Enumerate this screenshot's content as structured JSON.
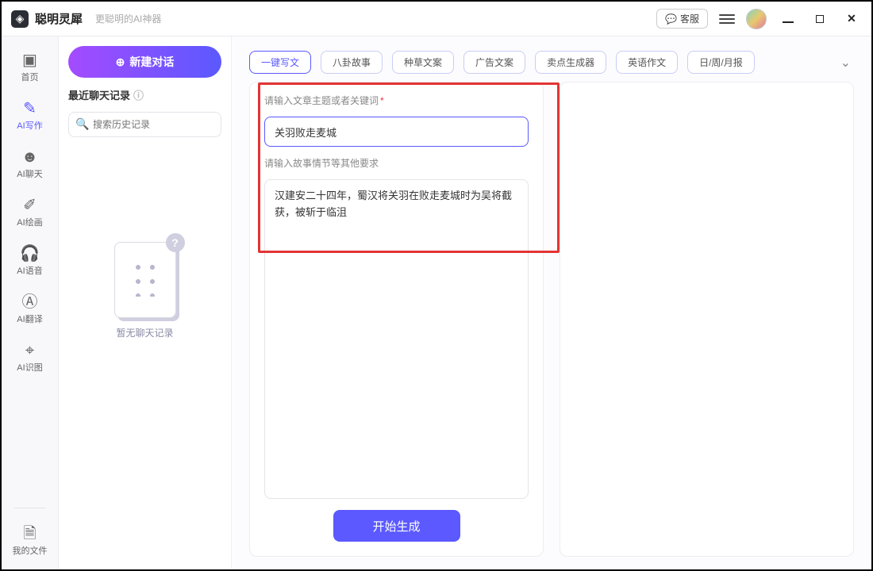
{
  "titlebar": {
    "brand_name": "聪明灵犀",
    "brand_sub": "更聪明的AI神器",
    "kefu_label": "客服"
  },
  "nav": {
    "items": [
      {
        "label": "首页"
      },
      {
        "label": "AI写作"
      },
      {
        "label": "AI聊天"
      },
      {
        "label": "AI绘画"
      },
      {
        "label": "AI语音"
      },
      {
        "label": "AI翻译"
      },
      {
        "label": "AI识图"
      }
    ],
    "bottom_label": "我的文件"
  },
  "history": {
    "new_chat_label": "新建对话",
    "section_title": "最近聊天记录",
    "search_placeholder": "搜索历史记录",
    "empty_text": "暂无聊天记录"
  },
  "categories": {
    "items": [
      "一键写文",
      "八卦故事",
      "种草文案",
      "广告文案",
      "卖点生成器",
      "英语作文",
      "日/周/月报"
    ],
    "active_index": 0
  },
  "form": {
    "topic_label": "请输入文章主题或者关键词",
    "topic_value": "关羽败走麦城",
    "detail_label": "请输入故事情节等其他要求",
    "detail_value": "汉建安二十四年，蜀汉将关羽在败走麦城时为吴将截获，被斩于临沮",
    "cta_label": "开始生成"
  }
}
